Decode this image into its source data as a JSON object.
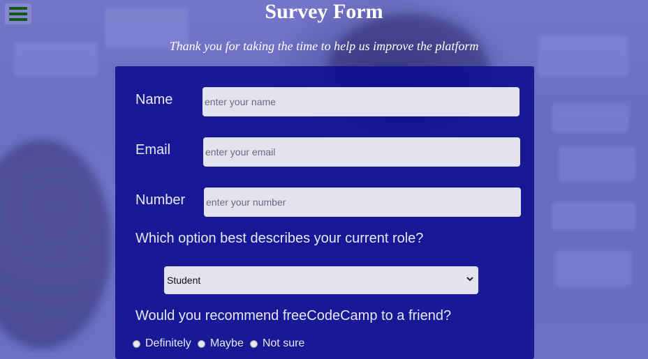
{
  "title": "Survey Form",
  "subtitle": "Thank you for taking the time to help us improve the platform",
  "menu": {
    "icon": "hamburger-menu-icon"
  },
  "form": {
    "name_label": "Name",
    "name_placeholder": "enter your name",
    "email_label": "Email",
    "email_placeholder": "enter your email",
    "number_label": "Number",
    "number_placeholder": "enter your number",
    "role_question": "Which option best describes your current role?",
    "role_selected": "Student",
    "recommend_question": "Would you recommend freeCodeCamp to a friend?",
    "recommend_options": [
      "Definitely",
      "Maybe",
      "Not sure"
    ]
  },
  "colors": {
    "card": "#10108f",
    "menu_icon": "#0e5a1e",
    "input_bg": "#e3e3f0"
  }
}
